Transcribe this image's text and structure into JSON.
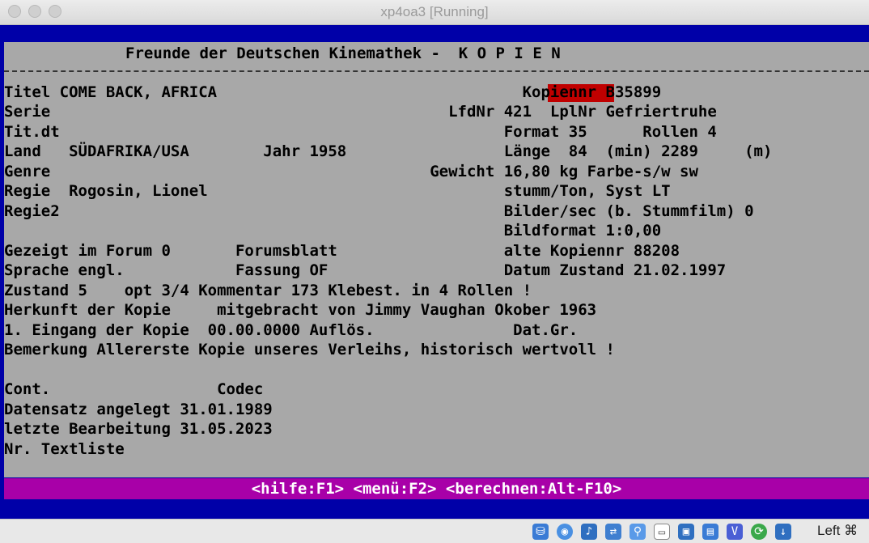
{
  "window": {
    "title": "xp4oa3 [Running]"
  },
  "screen": {
    "header": "Freunde der Deutschen Kinemathek -  K O P I E N",
    "lines": [
      "Titel COME BACK, AFRICA                                 Kopiennr B35899",
      "Serie                                           LfdNr 421  LplNr Gefriertruhe",
      "Tit.dt                                                Format 35      Rollen 4",
      "Land   SÜDAFRIKA/USA        Jahr 1958                 Länge  84  (min) 2289     (m)",
      "Genre                                         Gewicht 16,80 kg Farbe-s/w sw",
      "Regie  Rogosin, Lionel                                stumm/Ton, Syst LT",
      "Regie2                                                Bilder/sec (b. Stummfilm) 0",
      "                                                      Bildformat 1:0,00",
      "Gezeigt im Forum 0       Forumsblatt                  alte Kopiennr 88208",
      "Sprache engl.            Fassung OF                   Datum Zustand 21.02.1997",
      "Zustand 5    opt 3/4 Kommentar 173 Klebest. in 4 Rollen !",
      "Herkunft der Kopie     mitgebracht von Jimmy Vaughan Okober 1963",
      "1. Eingang der Kopie  00.00.0000 Auflös.               Dat.Gr.",
      "Bemerkung Allererste Kopie unseres Verleihs, historisch wertvoll !",
      "",
      "Cont.                  Codec",
      "Datensatz angelegt 31.01.1989",
      "letzte Bearbeitung 31.05.2023",
      "Nr. Textliste"
    ],
    "helpbar": "<hilfe:F1> <menü:F2> <berechnen:Alt-F10>",
    "colors": {
      "background": "#a8a8a8",
      "border": "#0000a8",
      "helpbar": "#a800a8",
      "field_marker": "#c00000"
    }
  },
  "statusbar": {
    "icons": [
      "hard-disk-icon",
      "optical-drive-icon",
      "audio-icon",
      "network-icon",
      "usb-icon",
      "shared-folders-icon",
      "display-icon",
      "video-capture-icon",
      "cpu-icon",
      "mouse-integration-icon",
      "keyboard-icon"
    ],
    "host_key": "Left ⌘"
  }
}
